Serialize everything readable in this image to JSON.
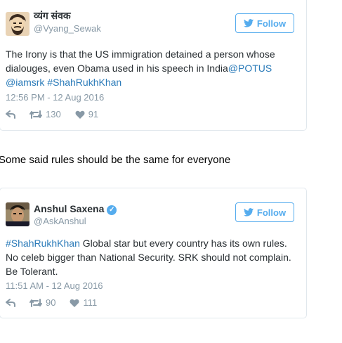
{
  "tweets": [
    {
      "name": "व्यंग संवक",
      "handle": "@Vyang_Sewak",
      "verified": false,
      "follow_label": "Follow",
      "text_parts": {
        "p1": "The Irony is that the US immigration detained a person whose dialouges, even Obama used in his speech in India",
        "p2": "@POTUS",
        "p3": " ",
        "p4": "@iamsrk",
        "p5": " ",
        "p6": "#ShahRukhKhan"
      },
      "timestamp": "12:56 PM - 12 Aug 2016",
      "retweets": "130",
      "likes": "91"
    },
    {
      "name": "Anshul Saxena",
      "handle": "@AskAnshul",
      "verified": true,
      "follow_label": "Follow",
      "text_parts": {
        "p1": "#ShahRukhKhan",
        "p2": " Global star but every country has its own rules. No celeb bigger than National Security. SRK should not complain. Be Tolerant."
      },
      "timestamp": "11:51 AM - 12 Aug 2016",
      "retweets": "90",
      "likes": "111"
    }
  ],
  "caption": "Some said rules should be the same for everyone",
  "colors": {
    "link": "#2b7bb9",
    "follow": "#55acee",
    "meta": "#8899a6",
    "text": "#292f33",
    "border": "#e1e8ed"
  },
  "icons": {
    "follow": "twitter-bird-icon",
    "reply": "reply-icon",
    "retweet": "retweet-icon",
    "like": "heart-icon",
    "verified": "verified-badge-icon"
  }
}
